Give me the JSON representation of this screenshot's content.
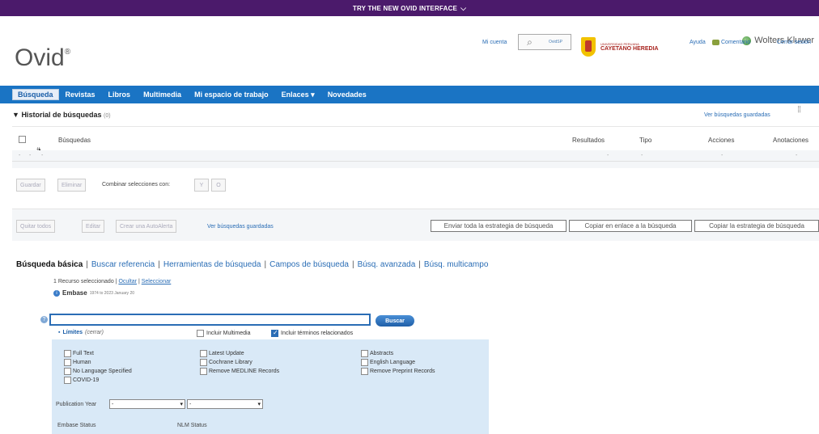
{
  "banner": {
    "text": "TRY THE NEW OVID INTERFACE"
  },
  "header": {
    "logo": "Ovid",
    "logo_mark": "®",
    "brand": "Wolters Kluwer",
    "mi_cuenta": "Mi cuenta",
    "ovidsp": "OvidSP",
    "institution": "CAYETANO HEREDIA",
    "institution_sub": "UNIVERSIDAD PERUANA",
    "ayuda": "Ayuda",
    "comentario": "Comentario",
    "cerrar_sesion": "Cerrar sesión"
  },
  "nav": {
    "items": [
      "Búsqueda",
      "Revistas",
      "Libros",
      "Multimedia",
      "Mi espacio de trabajo",
      "Enlaces",
      "Novedades"
    ],
    "active_index": 0
  },
  "history": {
    "title": "Historial de búsquedas",
    "count": "(0)",
    "ver_guardadas": "Ver búsquedas guardadas",
    "columns": {
      "num": "#",
      "busquedas": "Búsquedas",
      "resultados": "Resultados",
      "tipo": "Tipo",
      "acciones": "Acciones",
      "anotaciones": "Anotaciones"
    },
    "row": {
      "c1": "-",
      "c2": "-",
      "c3": "-",
      "c4": "-",
      "c5": "-",
      "c6": "-",
      "c7": "-"
    }
  },
  "history_actions": {
    "guardar": "Guardar",
    "eliminar": "Eliminar",
    "combinar_label": "Combinar selecciones con:",
    "y": "Y",
    "o": "O"
  },
  "toolbar2": {
    "quitar_todos": "Quitar todos",
    "editar": "Editar",
    "crear_autoalerta": "Crear una AutoAlerta",
    "ver_guardadas": "Ver búsquedas guardadas",
    "enviar_estrategia": "Enviar toda la estrategia de búsqueda",
    "copiar_enlace": "Copiar en enlace a la búsqueda",
    "copiar_estrategia": "Copiar la estrategia de búsqueda"
  },
  "search_tabs": {
    "items": [
      "Búsqueda básica",
      "Buscar referencia",
      "Herramientas de búsqueda",
      "Campos de búsqueda",
      "Búsq. avanzada",
      "Búsq. multicampo"
    ],
    "active_index": 0
  },
  "resources": {
    "selected_text": "1 Recurso seleccionado |",
    "ocultar": "Ocultar",
    "seleccionar": "Seleccionar",
    "database": "Embase",
    "range": "1974 to 2023 January 20"
  },
  "search": {
    "value": "",
    "placeholder": "",
    "button": "Buscar"
  },
  "limits": {
    "title": "Límites",
    "cerrar": "(cerrar)",
    "incluir_multimedia": "Incluir Multimedia",
    "incluir_terminos": "Incluir términos relacionados",
    "col1": [
      "Full Text",
      "Human",
      "No Language Specified",
      "COVID-19"
    ],
    "col2": [
      "Latest Update",
      "Cochrane Library",
      "Remove MEDLINE Records"
    ],
    "col3": [
      "Abstracts",
      "English Language",
      "Remove Preprint Records"
    ],
    "publication_year_label": "Publication Year",
    "year_from": "-",
    "year_to": "-",
    "embase_status": "Embase Status",
    "nlm_status": "NLM Status"
  }
}
